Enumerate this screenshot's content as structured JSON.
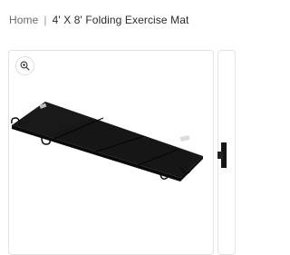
{
  "breadcrumb": {
    "home_label": "Home",
    "separator": "|",
    "current_label": "4' X 8' Folding Exercise Mat"
  },
  "gallery": {
    "zoom_icon": "zoom-in-icon",
    "image_subject": "black-folding-exercise-mat"
  },
  "colors": {
    "mat": "#141414",
    "text_primary": "#2b2b2b",
    "text_muted": "#6b6b6b",
    "border": "#e3e3e3"
  }
}
